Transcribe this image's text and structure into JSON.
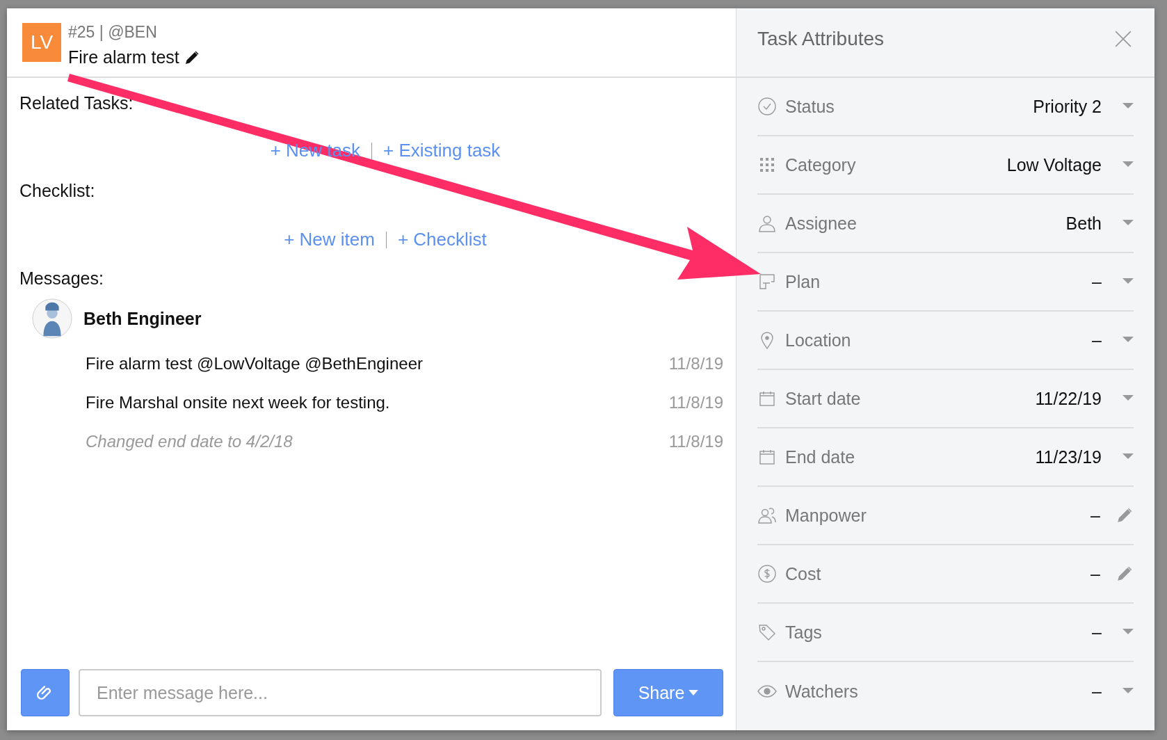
{
  "header": {
    "badge": "LV",
    "meta": "#25 | @BEN",
    "title": "Fire alarm test"
  },
  "related_tasks": {
    "label": "Related Tasks:",
    "links": [
      "+ New task",
      "+ Existing task"
    ]
  },
  "checklist": {
    "label": "Checklist:",
    "links": [
      "+ New item",
      "+ Checklist"
    ]
  },
  "messages": {
    "label": "Messages:",
    "author": "Beth Engineer",
    "items": [
      {
        "kind": "text",
        "text": "Fire alarm test @LowVoltage @BethEngineer",
        "date": "11/8/19"
      },
      {
        "kind": "text",
        "text": "Fire Marshal onsite next week for testing.",
        "date": "11/8/19"
      },
      {
        "kind": "event",
        "text": "Changed end date to 4/2/18",
        "date": "11/8/19"
      }
    ]
  },
  "composer": {
    "placeholder": "Enter message here...",
    "share": "Share"
  },
  "attributes": {
    "title": "Task Attributes",
    "rows": [
      {
        "kind": "dropdown",
        "label": "Status",
        "value": "Priority 2"
      },
      {
        "kind": "dropdown",
        "label": "Category",
        "value": "Low Voltage"
      },
      {
        "kind": "dropdown",
        "label": "Assignee",
        "value": "Beth"
      },
      {
        "kind": "dropdown",
        "label": "Plan",
        "value": "–"
      },
      {
        "kind": "dropdown",
        "label": "Location",
        "value": "–"
      },
      {
        "kind": "dropdown",
        "label": "Start date",
        "value": "11/22/19"
      },
      {
        "kind": "dropdown",
        "label": "End date",
        "value": "11/23/19"
      },
      {
        "kind": "edit",
        "label": "Manpower",
        "value": "–"
      },
      {
        "kind": "edit",
        "label": "Cost",
        "value": "–"
      },
      {
        "kind": "dropdown",
        "label": "Tags",
        "value": "–"
      },
      {
        "kind": "dropdown",
        "label": "Watchers",
        "value": "–"
      }
    ]
  }
}
